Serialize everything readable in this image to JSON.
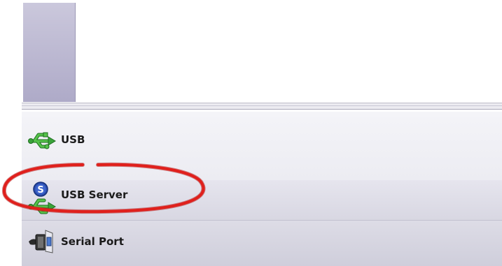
{
  "nav": {
    "items": [
      {
        "label": "USB",
        "icon": "usb-icon"
      },
      {
        "label": "USB Server",
        "icon": "usb-server-icon",
        "badge": "S"
      },
      {
        "label": "Serial Port",
        "icon": "serial-port-icon"
      }
    ]
  },
  "colors": {
    "usb_green": "#3aa33a",
    "badge_blue": "#2c4fb0",
    "highlight_red": "#e0201c",
    "strip": "#b9b6cf"
  }
}
